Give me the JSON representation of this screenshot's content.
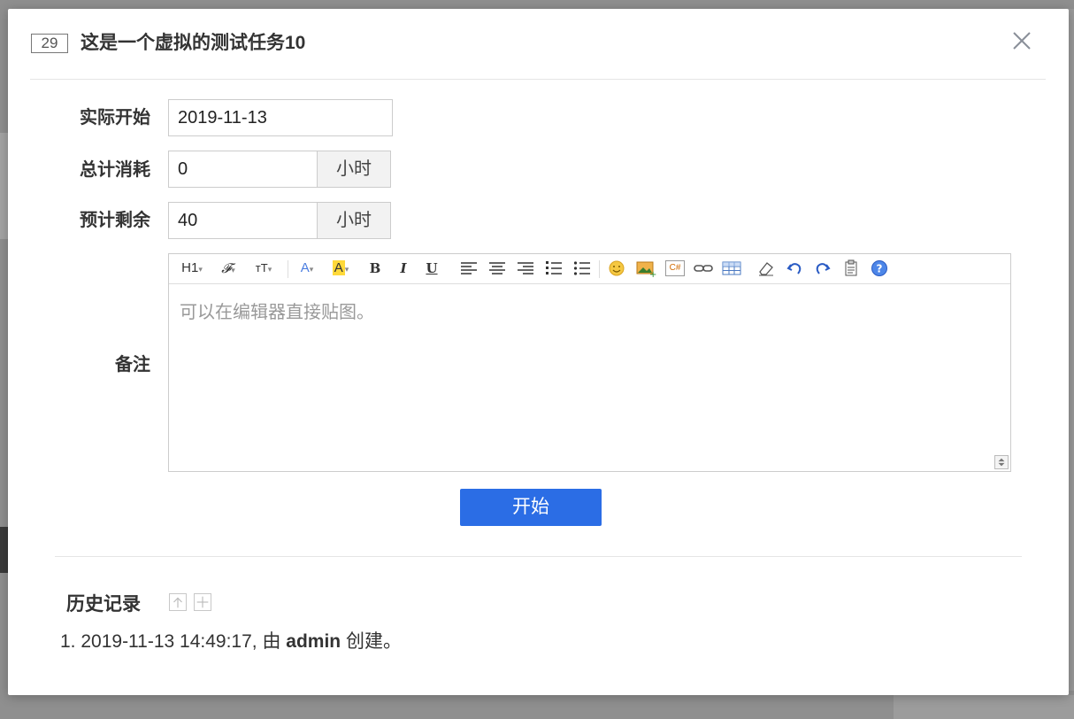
{
  "dialog": {
    "task_id": "29",
    "task_title": "这是一个虚拟的测试任务10",
    "close_symbol": "×"
  },
  "form": {
    "actual_start_label": "实际开始",
    "actual_start_value": "2019-11-13",
    "total_consumed_label": "总计消耗",
    "total_consumed_value": "0",
    "total_consumed_unit": "小时",
    "estimated_left_label": "预计剩余",
    "estimated_left_value": "40",
    "estimated_left_unit": "小时",
    "notes_label": "备注",
    "notes_placeholder": "可以在编辑器直接贴图。"
  },
  "toolbar": {
    "heading": "H1",
    "font_family": "𝓕",
    "font_size": "тT",
    "font_color": "A",
    "bg_color": "A",
    "bold": "B",
    "italic": "I",
    "underline": "U",
    "code": "C#"
  },
  "actions": {
    "start_label": "开始"
  },
  "history": {
    "title": "历史记录",
    "item_prefix": "1. 2019-11-13 14:49:17, 由 ",
    "item_user": "admin",
    "item_suffix": " 创建。"
  },
  "colors": {
    "primary": "#2b6de5",
    "overlay": "#8e8e8e"
  }
}
